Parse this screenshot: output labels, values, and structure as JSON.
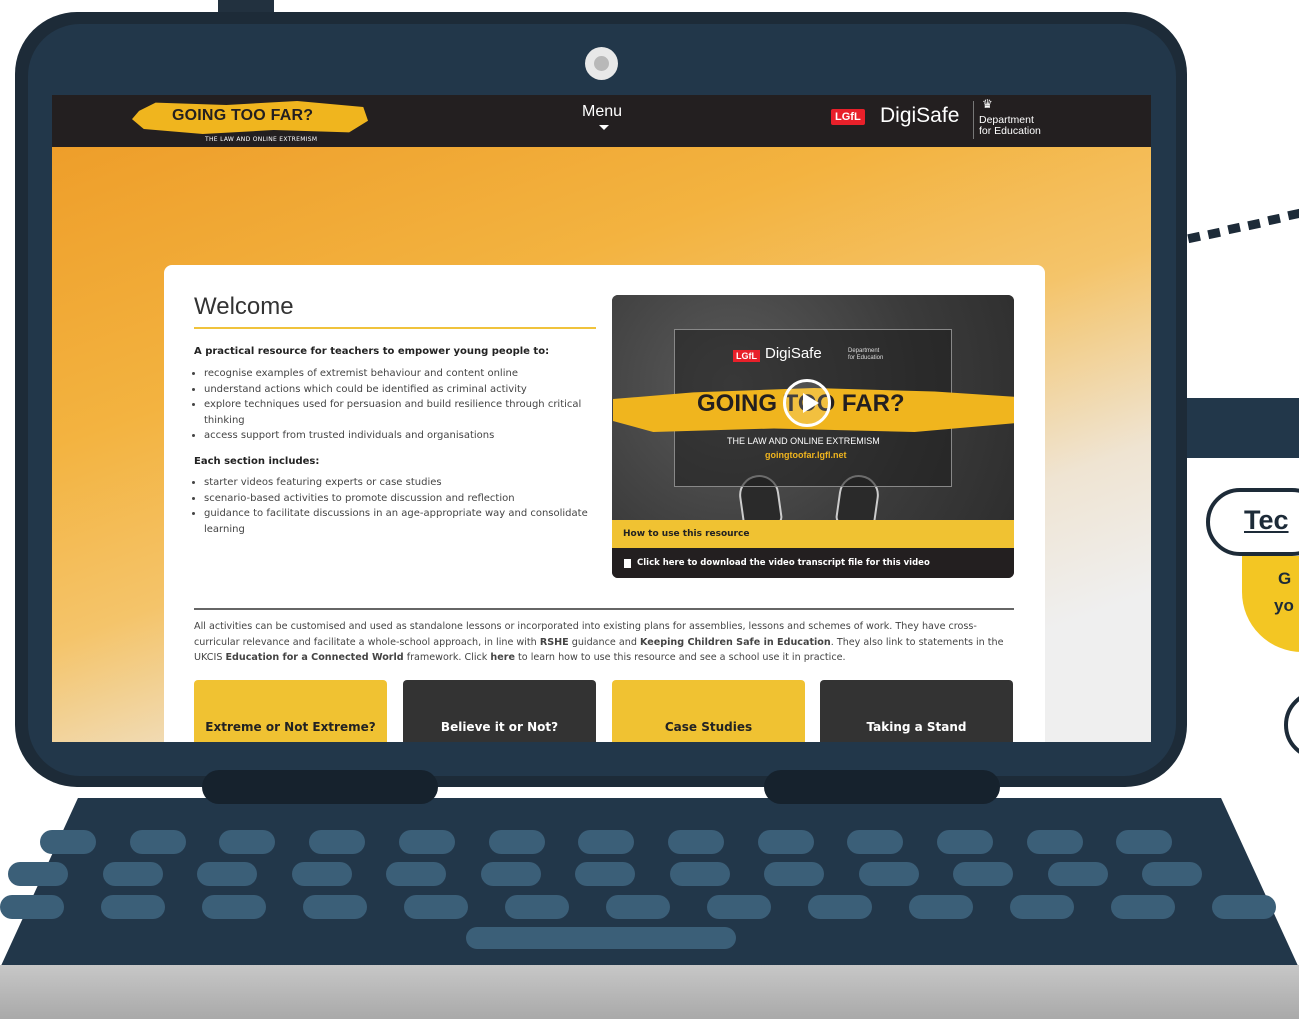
{
  "header": {
    "logo_title": "GOING TOO FAR?",
    "logo_subtitle": "THE LAW AND ONLINE EXTREMISM",
    "menu_label": "Menu",
    "lgfl_badge": "LGfL",
    "digisafe": "DigiSafe",
    "dfe_line1": "Department",
    "dfe_line2": "for Education"
  },
  "welcome": {
    "title": "Welcome",
    "intro": "A practical resource for teachers to empower young people to:",
    "bullets": [
      "recognise examples of extremist behaviour and content online",
      "understand actions which could be identified as criminal activity",
      "explore techniques used for persuasion and build resilience through critical thinking",
      "access support from trusted individuals and organisations"
    ],
    "section_heading": "Each section includes:",
    "section_bullets": [
      "starter videos featuring experts or case studies",
      "scenario-based activities to promote discussion and reflection",
      "guidance to facilitate discussions in an age-appropriate way and consolidate learning"
    ]
  },
  "video": {
    "lgfl": "LGfL",
    "digisafe": "DigiSafe",
    "dfe_line1": "Department",
    "dfe_line2": "for Education",
    "title": "GOING TOO FAR?",
    "subtitle": "THE LAW AND ONLINE EXTREMISM",
    "url": "goingtoofar.lgfl.net",
    "how_to": "How to use this resource",
    "download": "Click here to download the video transcript file for this video"
  },
  "paragraph": {
    "p1": "All activities can be customised and used as standalone lessons or incorporated into existing plans for assemblies, lessons and schemes of work. They have cross-curricular relevance and facilitate a whole-school approach, in line with ",
    "b1": "RSHE",
    "p2": " guidance and ",
    "b2": "Keeping Children Safe in Education",
    "p3": ". They also link to statements in the UKCIS ",
    "b3": "Education for a Connected World",
    "p4": " framework. Click ",
    "b4": "here",
    "p5": " to learn how to use this resource and see a school use it in practice."
  },
  "tiles": [
    "Extreme or Not Extreme?",
    "Believe it or Not?",
    "Case Studies",
    "Taking a Stand"
  ],
  "side": {
    "pill_label": "Tec",
    "yellow_line1": "G",
    "yellow_line2": "yo"
  },
  "colors": {
    "laptop": "#22374a",
    "accent": "#f0c232",
    "dark": "#231f20",
    "lgfl_red": "#e8202a"
  }
}
